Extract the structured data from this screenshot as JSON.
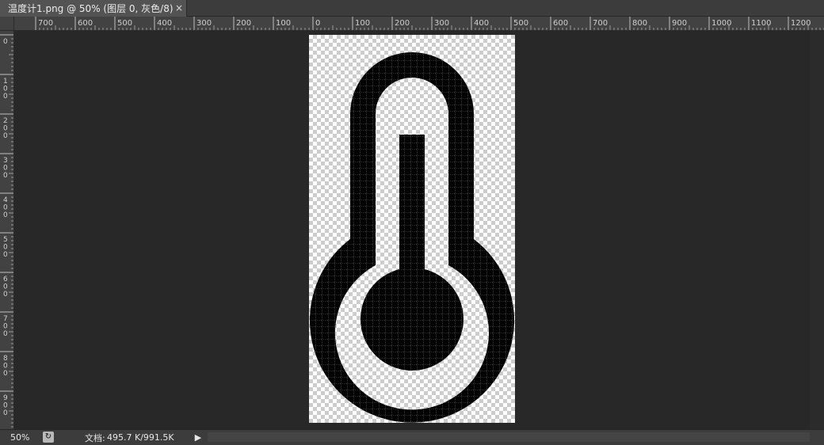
{
  "document_tab": {
    "title": "温度计1.png @ 50% (图层 0, 灰色/8)",
    "close_glyph": "×"
  },
  "ruler": {
    "horizontal_labels": [
      "700",
      "600",
      "500",
      "400",
      "300",
      "200",
      "100",
      "0",
      "100",
      "200",
      "300",
      "400",
      "500",
      "600",
      "700",
      "800",
      "900",
      "1000",
      "1100",
      "1200"
    ],
    "vertical_labels": [
      "0",
      "100",
      "200",
      "300",
      "400",
      "500",
      "600",
      "700",
      "800",
      "900"
    ]
  },
  "status": {
    "zoom": "50%",
    "doc_label": "文档:",
    "doc_size": "495.7 K/991.5K",
    "menu_arrow": "▶"
  },
  "colors": {
    "workspace": "#282828",
    "icon_fill": "#000000",
    "checker_dark": "#cccccc",
    "checker_light": "#ffffff"
  },
  "canvas": {
    "icon_name": "thermometer-icon",
    "pixel_grid": true
  }
}
